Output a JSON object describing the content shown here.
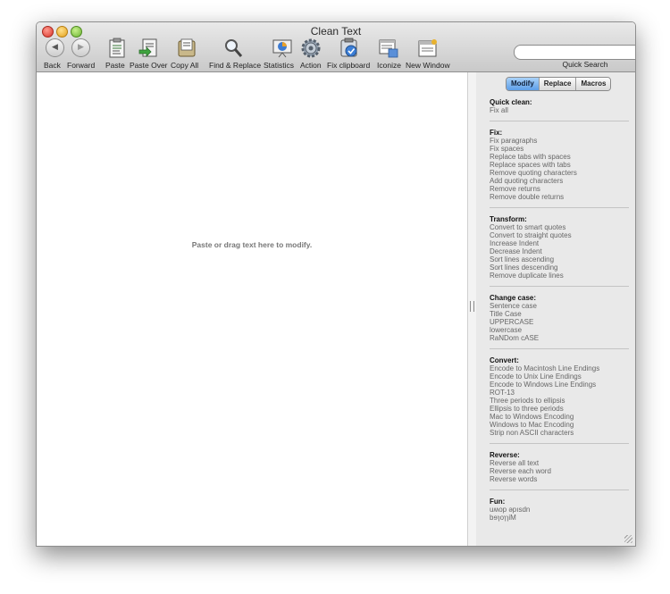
{
  "window": {
    "title": "Clean Text"
  },
  "toolbar": {
    "back": "Back",
    "forward": "Forward",
    "paste": "Paste",
    "paste_over": "Paste Over",
    "copy_all": "Copy All",
    "find_replace": "Find & Replace",
    "statistics": "Statistics",
    "action": "Action",
    "fix_clipboard": "Fix clipboard",
    "iconize": "Iconize",
    "new_window": "New Window",
    "quick_search_label": "Quick Search",
    "quick_search_value": ""
  },
  "editor": {
    "placeholder": "Paste or drag text here to modify."
  },
  "sidebar": {
    "tabs": [
      "Modify",
      "Replace",
      "Macros"
    ],
    "active_tab": "Modify",
    "groups": [
      {
        "title": "Quick clean:",
        "items": [
          "Fix all"
        ]
      },
      {
        "title": "Fix:",
        "items": [
          "Fix paragraphs",
          "Fix spaces",
          "Replace tabs with spaces",
          "Replace spaces with tabs",
          "Remove quoting characters",
          "Add quoting characters",
          "Remove returns",
          "Remove double returns"
        ]
      },
      {
        "title": "Transform:",
        "items": [
          "Convert to smart quotes",
          "Convert to straight quotes",
          "Increase Indent",
          "Decrease Indent",
          "Sort lines ascending",
          "Sort lines descending",
          "Remove duplicate lines"
        ]
      },
      {
        "title": "Change case:",
        "items": [
          "Sentence case",
          "Title Case",
          "UPPERCASE",
          "lowercase",
          "RaNDom cASE"
        ]
      },
      {
        "title": "Convert:",
        "items": [
          "Encode to Macintosh Line Endings",
          "Encode to Unix Line Endings",
          "Encode to Windows Line Endings",
          "ROT-13",
          "Three periods to ellipsis",
          "Ellipsis to three periods",
          "Mac to Windows Encoding",
          "Windows to Mac Encoding",
          "Strip non ASCII characters"
        ]
      },
      {
        "title": "Reverse:",
        "items": [
          "Reverse all text",
          "Reverse each word",
          "Reverse words"
        ]
      },
      {
        "title": "Fun:",
        "items": [
          "uʍop ǝpısdn",
          "bɘɿoɿɿiM"
        ]
      }
    ]
  },
  "colors": {
    "accent": "#5d9ee8",
    "titlebar_top": "#e9e9e9",
    "titlebar_bottom": "#c9c9c9",
    "sidebar_bg": "#e9e9e9"
  }
}
